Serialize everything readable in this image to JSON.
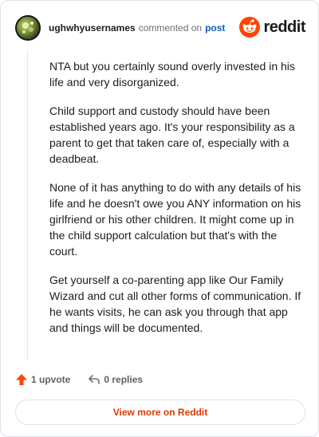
{
  "comment": {
    "author": "ughwhyusernames",
    "action_text": "commented on",
    "post_link_label": "post",
    "paragraphs": [
      "NTA but you certainly sound overly invested in his life and very disorganized.",
      "Child support and custody should have been established years ago. It's your responsibility as a parent to get that taken care of, especially with a deadbeat.",
      "None of it has anything to do with any details of his life and he doesn't owe you ANY information on his girlfriend or his other children. It might come up in the child support calculation but that's with the court.",
      "Get yourself a co-parenting app like Our Family Wizard and cut all other forms of communication. If he wants visits, he can ask you through that app and things will be documented."
    ],
    "upvote_label": "1 upvote",
    "replies_label": "0 replies"
  },
  "brand": {
    "name": "reddit",
    "color": "#ff4500"
  },
  "footer": {
    "view_more_label": "View more on Reddit"
  },
  "colors": {
    "link": "#0a5ac2",
    "upvote": "#ff4500",
    "view_more": "#d93a00"
  }
}
